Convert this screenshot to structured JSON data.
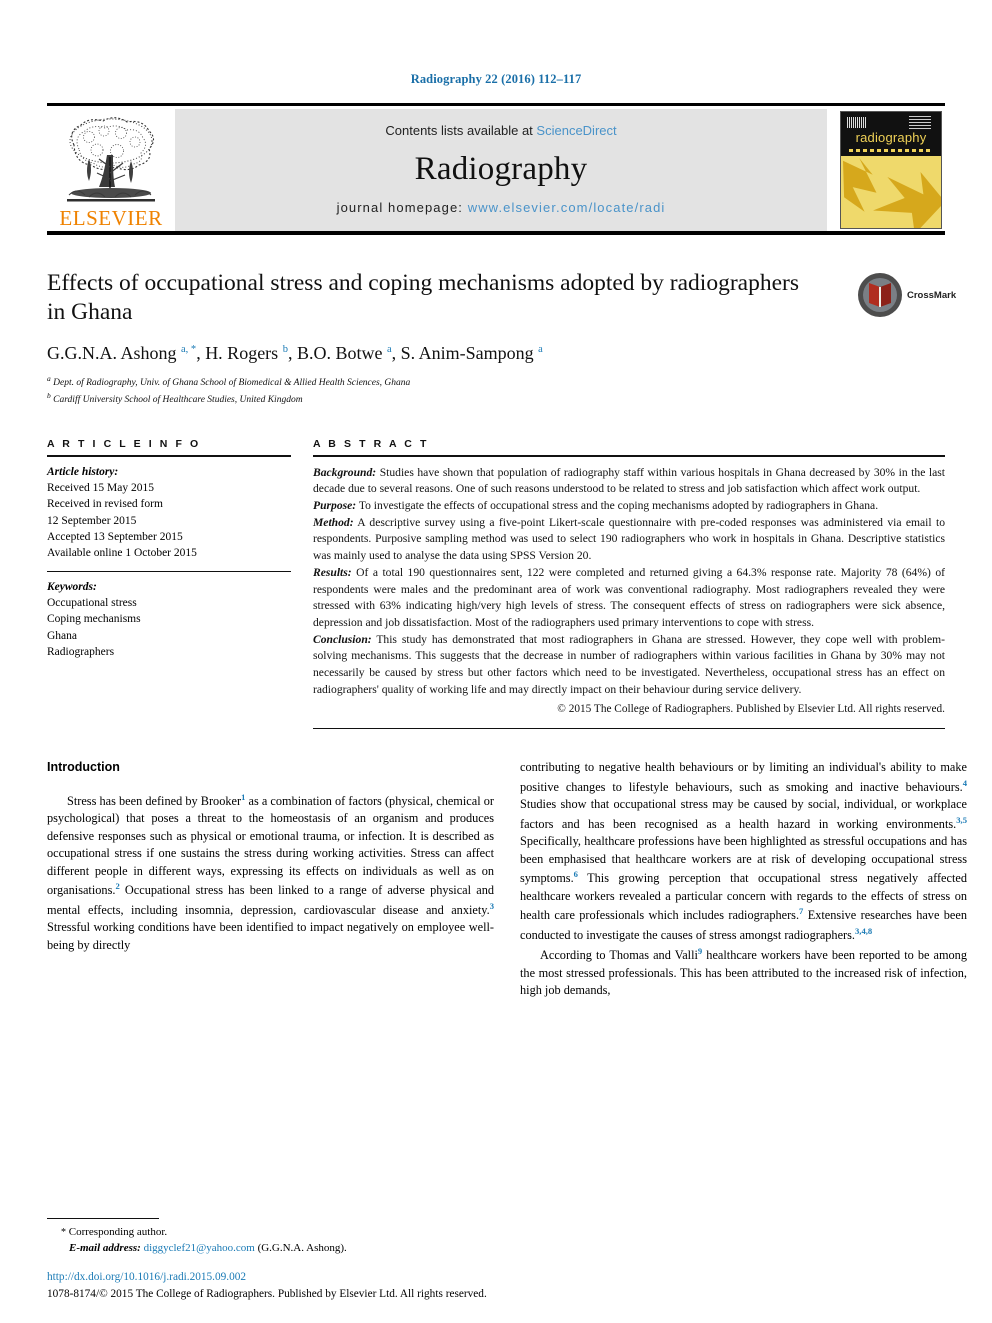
{
  "running_head": "Radiography 22 (2016) 112–117",
  "masthead": {
    "contents_prefix": "Contents lists available at",
    "sciencedirect": "ScienceDirect",
    "journal_name": "Radiography",
    "homepage_prefix": "journal homepage:",
    "homepage_url": "www.elsevier.com/locate/radi",
    "publisher": "ELSEVIER",
    "cover_title": "radiography",
    "link_color": "#4a93c9",
    "publisher_color": "#ef8200",
    "cover_color": "#efd157"
  },
  "article": {
    "title": "Effects of occupational stress and coping mechanisms adopted by radiographers in Ghana",
    "authors_html": "G.G.N.A. Ashong <sup>a, *</sup>, H. Rogers <sup>b</sup>, B.O. Botwe <sup>a</sup>, S. Anim-Sampong <sup>a</sup>",
    "affiliations": [
      {
        "marker": "a",
        "text": "Dept. of Radiography, Univ. of Ghana School of Biomedical & Allied Health Sciences, Ghana"
      },
      {
        "marker": "b",
        "text": "Cardiff University School of Healthcare Studies, United Kingdom"
      }
    ],
    "crossmark_label": "CrossMark"
  },
  "article_info": {
    "heading": "A R T I C L E   I N F O",
    "history_label": "Article history:",
    "history": [
      "Received 15 May 2015",
      "Received in revised form",
      "12 September 2015",
      "Accepted 13 September 2015",
      "Available online 1 October 2015"
    ],
    "keywords_label": "Keywords:",
    "keywords": [
      "Occupational stress",
      "Coping mechanisms",
      "Ghana",
      "Radiographers"
    ]
  },
  "abstract": {
    "heading": "A B S T R A C T",
    "sections": [
      {
        "label": "Background:",
        "text": " Studies have shown that population of radiography staff within various hospitals in Ghana decreased by 30% in the last decade due to several reasons. One of such reasons understood to be related to stress and job satisfaction which affect work output."
      },
      {
        "label": "Purpose:",
        "text": " To investigate the effects of occupational stress and the coping mechanisms adopted by radiographers in Ghana."
      },
      {
        "label": "Method:",
        "text": " A descriptive survey using a five-point Likert-scale questionnaire with pre-coded responses was administered via email to respondents. Purposive sampling method was used to select 190 radiographers who work in hospitals in Ghana. Descriptive statistics was mainly used to analyse the data using SPSS Version 20."
      },
      {
        "label": "Results:",
        "text": " Of a total 190 questionnaires sent, 122 were completed and returned giving a 64.3% response rate. Majority 78 (64%) of respondents were males and the predominant area of work was conventional radiography. Most radiographers revealed they were stressed with 63% indicating high/very high levels of stress. The consequent effects of stress on radiographers were sick absence, depression and job dissatisfaction. Most of the radiographers used primary interventions to cope with stress."
      },
      {
        "label": "Conclusion:",
        "text": " This study has demonstrated that most radiographers in Ghana are stressed. However, they cope well with problem-solving mechanisms. This suggests that the decrease in number of radiographers within various facilities in Ghana by 30% may not necessarily be caused by stress but other factors which need to be investigated. Nevertheless, occupational stress has an effect on radiographers' quality of working life and may directly impact on their behaviour during service delivery."
      }
    ],
    "copyright": "© 2015 The College of Radiographers. Published by Elsevier Ltd. All rights reserved."
  },
  "introduction": {
    "heading": "Introduction",
    "left_paragraphs": [
      "Stress has been defined by Brooker<sup class=\"ref\">1</sup> as a combination of factors (physical, chemical or psychological) that poses a threat to the homeostasis of an organism and produces defensive responses such as physical or emotional trauma, or infection. It is described as occupational stress if one sustains the stress during working activities. Stress can affect different people in different ways, expressing its effects on individuals as well as on organisations.<sup class=\"ref\">2</sup> Occupational stress has been linked to a range of adverse physical and mental effects, including insomnia, depression, cardiovascular disease and anxiety.<sup class=\"ref\">3</sup> Stressful working conditions have been identified to impact negatively on employee well-being by directly"
    ],
    "right_paragraphs": [
      "contributing to negative health behaviours or by limiting an individual's ability to make positive changes to lifestyle behaviours, such as smoking and inactive behaviours.<sup class=\"ref\">4</sup> Studies show that occupational stress may be caused by social, individual, or workplace factors and has been recognised as a health hazard in working environments.<sup class=\"ref\">3,5</sup> Specifically, healthcare professions have been highlighted as stressful occupations and has been emphasised that healthcare workers are at risk of developing occupational stress symptoms.<sup class=\"ref\">6</sup> This growing perception that occupational stress negatively affected healthcare workers revealed a particular concern with regards to the effects of stress on health care professionals which includes radiographers.<sup class=\"ref\">7</sup> Extensive researches have been conducted to investigate the causes of stress amongst radiographers.<sup class=\"ref\">3,4,8</sup>",
      "According to Thomas and Valli<sup class=\"ref\">9</sup> healthcare workers have been reported to be among the most stressed professionals. This has been attributed to the increased risk of infection, high job demands,"
    ]
  },
  "footnote": {
    "corresponding_marker": "*",
    "corresponding_label": "Corresponding author.",
    "email_label": "E-mail address:",
    "email": "diggyclef21@yahoo.com",
    "email_owner": "(G.G.N.A. Ashong)."
  },
  "footer": {
    "doi": "http://dx.doi.org/10.1016/j.radi.2015.09.002",
    "issn_line": "1078-8174/© 2015 The College of Radiographers. Published by Elsevier Ltd. All rights reserved."
  }
}
